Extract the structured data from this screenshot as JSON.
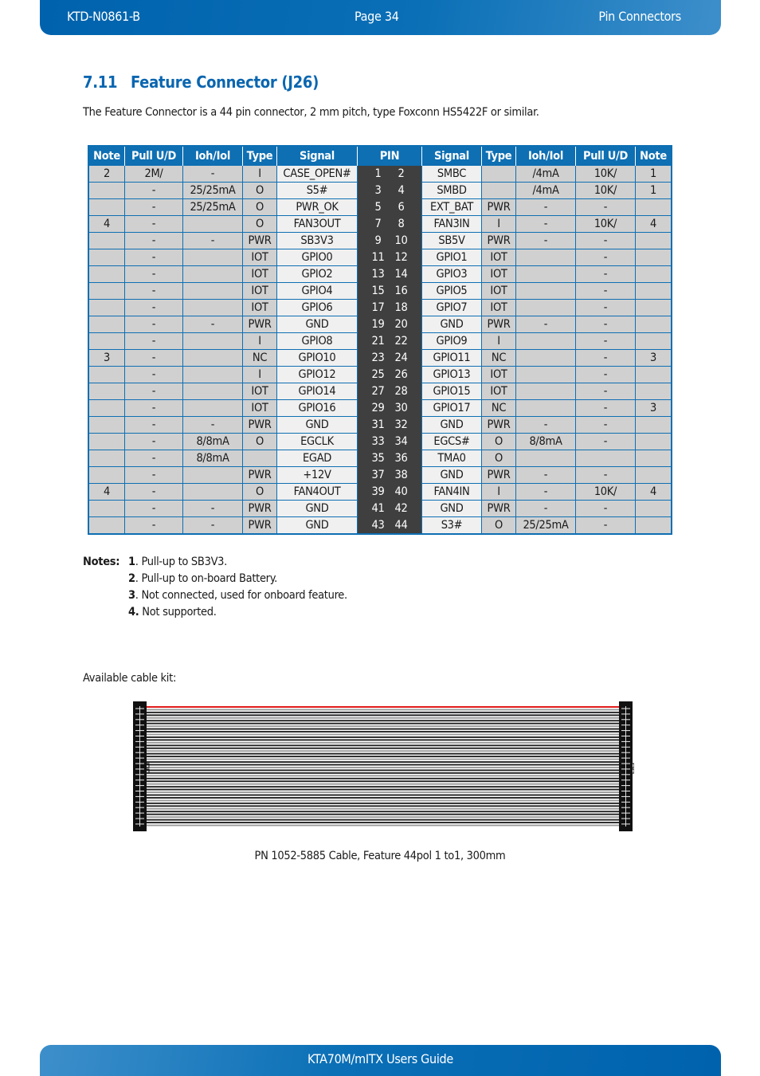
{
  "header": {
    "doc_id": "KTD-N0861-B",
    "page": "Page 34",
    "section": "Pin Connectors"
  },
  "footer": {
    "title": "KTA70M/mITX Users Guide"
  },
  "section": {
    "number": "7.11",
    "title": "Feature Connector (J26)"
  },
  "intro": "The Feature Connector is a 44 pin connector, 2 mm pitch,  type Foxconn HS5422F or similar.",
  "table": {
    "headers": [
      "Note",
      "Pull U/D",
      "Ioh/Iol",
      "Type",
      "Signal",
      "PIN",
      "Signal",
      "Type",
      "Ioh/Iol",
      "Pull U/D",
      "Note"
    ],
    "rows": [
      {
        "l_note": "2",
        "l_pull": "2M/",
        "l_ioh": "-",
        "l_type": "I",
        "l_sig": "CASE_OPEN#",
        "pin_l": "1",
        "pin_r": "2",
        "r_sig": "SMBC",
        "r_type": "",
        "r_ioh": "/4mA",
        "r_pull": "10K/",
        "r_note": "1"
      },
      {
        "l_note": "",
        "l_pull": "-",
        "l_ioh": "25/25mA",
        "l_type": "O",
        "l_sig": "S5#",
        "pin_l": "3",
        "pin_r": "4",
        "r_sig": "SMBD",
        "r_type": "",
        "r_ioh": "/4mA",
        "r_pull": "10K/",
        "r_note": "1"
      },
      {
        "l_note": "",
        "l_pull": "-",
        "l_ioh": "25/25mA",
        "l_type": "O",
        "l_sig": "PWR_OK",
        "pin_l": "5",
        "pin_r": "6",
        "r_sig": "EXT_BAT",
        "r_type": "PWR",
        "r_ioh": "-",
        "r_pull": "-",
        "r_note": ""
      },
      {
        "l_note": "4",
        "l_pull": "-",
        "l_ioh": "",
        "l_type": "O",
        "l_sig": "FAN3OUT",
        "pin_l": "7",
        "pin_r": "8",
        "r_sig": "FAN3IN",
        "r_type": "I",
        "r_ioh": "-",
        "r_pull": "10K/",
        "r_note": "4"
      },
      {
        "l_note": "",
        "l_pull": "-",
        "l_ioh": "-",
        "l_type": "PWR",
        "l_sig": "SB3V3",
        "pin_l": "9",
        "pin_r": "10",
        "r_sig": "SB5V",
        "r_type": "PWR",
        "r_ioh": "-",
        "r_pull": "-",
        "r_note": ""
      },
      {
        "l_note": "",
        "l_pull": "-",
        "l_ioh": "",
        "l_type": "IOT",
        "l_sig": "GPIO0",
        "pin_l": "11",
        "pin_r": "12",
        "r_sig": "GPIO1",
        "r_type": "IOT",
        "r_ioh": "",
        "r_pull": "-",
        "r_note": ""
      },
      {
        "l_note": "",
        "l_pull": "-",
        "l_ioh": "",
        "l_type": "IOT",
        "l_sig": "GPIO2",
        "pin_l": "13",
        "pin_r": "14",
        "r_sig": "GPIO3",
        "r_type": "IOT",
        "r_ioh": "",
        "r_pull": "-",
        "r_note": ""
      },
      {
        "l_note": "",
        "l_pull": "-",
        "l_ioh": "",
        "l_type": "IOT",
        "l_sig": "GPIO4",
        "pin_l": "15",
        "pin_r": "16",
        "r_sig": "GPIO5",
        "r_type": "IOT",
        "r_ioh": "",
        "r_pull": "-",
        "r_note": ""
      },
      {
        "l_note": "",
        "l_pull": "-",
        "l_ioh": "",
        "l_type": "IOT",
        "l_sig": "GPIO6",
        "pin_l": "17",
        "pin_r": "18",
        "r_sig": "GPIO7",
        "r_type": "IOT",
        "r_ioh": "",
        "r_pull": "-",
        "r_note": ""
      },
      {
        "l_note": "",
        "l_pull": "-",
        "l_ioh": "-",
        "l_type": "PWR",
        "l_sig": "GND",
        "pin_l": "19",
        "pin_r": "20",
        "r_sig": "GND",
        "r_type": "PWR",
        "r_ioh": "-",
        "r_pull": "-",
        "r_note": ""
      },
      {
        "l_note": "",
        "l_pull": "-",
        "l_ioh": "",
        "l_type": "I",
        "l_sig": "GPIO8",
        "pin_l": "21",
        "pin_r": "22",
        "r_sig": "GPIO9",
        "r_type": "I",
        "r_ioh": "",
        "r_pull": "-",
        "r_note": ""
      },
      {
        "l_note": "3",
        "l_pull": "-",
        "l_ioh": "",
        "l_type": "NC",
        "l_sig": "GPIO10",
        "pin_l": "23",
        "pin_r": "24",
        "r_sig": "GPIO11",
        "r_type": "NC",
        "r_ioh": "",
        "r_pull": "-",
        "r_note": "3"
      },
      {
        "l_note": "",
        "l_pull": "-",
        "l_ioh": "",
        "l_type": "I",
        "l_sig": "GPIO12",
        "pin_l": "25",
        "pin_r": "26",
        "r_sig": "GPIO13",
        "r_type": "IOT",
        "r_ioh": "",
        "r_pull": "-",
        "r_note": ""
      },
      {
        "l_note": "",
        "l_pull": "-",
        "l_ioh": "",
        "l_type": "IOT",
        "l_sig": "GPIO14",
        "pin_l": "27",
        "pin_r": "28",
        "r_sig": "GPIO15",
        "r_type": "IOT",
        "r_ioh": "",
        "r_pull": "-",
        "r_note": ""
      },
      {
        "l_note": "",
        "l_pull": "-",
        "l_ioh": "",
        "l_type": "IOT",
        "l_sig": "GPIO16",
        "pin_l": "29",
        "pin_r": "30",
        "r_sig": "GPIO17",
        "r_type": "NC",
        "r_ioh": "",
        "r_pull": "-",
        "r_note": "3"
      },
      {
        "l_note": "",
        "l_pull": "-",
        "l_ioh": "-",
        "l_type": "PWR",
        "l_sig": "GND",
        "pin_l": "31",
        "pin_r": "32",
        "r_sig": "GND",
        "r_type": "PWR",
        "r_ioh": "-",
        "r_pull": "-",
        "r_note": ""
      },
      {
        "l_note": "",
        "l_pull": "-",
        "l_ioh": "8/8mA",
        "l_type": "O",
        "l_sig": "EGCLK",
        "pin_l": "33",
        "pin_r": "34",
        "r_sig": "EGCS#",
        "r_type": "O",
        "r_ioh": "8/8mA",
        "r_pull": "-",
        "r_note": ""
      },
      {
        "l_note": "",
        "l_pull": "-",
        "l_ioh": "8/8mA",
        "l_type": "",
        "l_sig": "EGAD",
        "pin_l": "35",
        "pin_r": "36",
        "r_sig": "TMA0",
        "r_type": "O",
        "r_ioh": "",
        "r_pull": "",
        "r_note": ""
      },
      {
        "l_note": "",
        "l_pull": "-",
        "l_ioh": "",
        "l_type": "PWR",
        "l_sig": "+12V",
        "pin_l": "37",
        "pin_r": "38",
        "r_sig": "GND",
        "r_type": "PWR",
        "r_ioh": "-",
        "r_pull": "-",
        "r_note": ""
      },
      {
        "l_note": "4",
        "l_pull": "-",
        "l_ioh": "",
        "l_type": "O",
        "l_sig": "FAN4OUT",
        "pin_l": "39",
        "pin_r": "40",
        "r_sig": "FAN4IN",
        "r_type": "I",
        "r_ioh": "-",
        "r_pull": "10K/",
        "r_note": "4"
      },
      {
        "l_note": "",
        "l_pull": "-",
        "l_ioh": "-",
        "l_type": "PWR",
        "l_sig": "GND",
        "pin_l": "41",
        "pin_r": "42",
        "r_sig": "GND",
        "r_type": "PWR",
        "r_ioh": "-",
        "r_pull": "-",
        "r_note": ""
      },
      {
        "l_note": "",
        "l_pull": "-",
        "l_ioh": "-",
        "l_type": "PWR",
        "l_sig": "GND",
        "pin_l": "43",
        "pin_r": "44",
        "r_sig": "S3#",
        "r_type": "O",
        "r_ioh": "25/25mA",
        "r_pull": "-",
        "r_note": ""
      }
    ]
  },
  "notes": {
    "label": "Notes:",
    "items": [
      {
        "num": "1",
        "text": ". Pull-up to SB3V3."
      },
      {
        "num": "2",
        "text": ". Pull-up to on-board Battery."
      },
      {
        "num": "3",
        "text": ". Not connected, used for onboard feature."
      },
      {
        "num": "4.",
        "text": " Not supported."
      }
    ]
  },
  "cable": {
    "label": "Available cable kit:",
    "caption": "PN 1052-5885 Cable, Feature 44pol 1 to1, 300mm",
    "wire_count": 44,
    "pin1_wire_color": "#e01010"
  },
  "colors": {
    "accent": "#0e6fb3",
    "heading": "#0a66b0",
    "pin_bg": "#3f3f3f",
    "cell_bg": "#d0d0d0",
    "signal_bg": "#f0f0f0"
  }
}
